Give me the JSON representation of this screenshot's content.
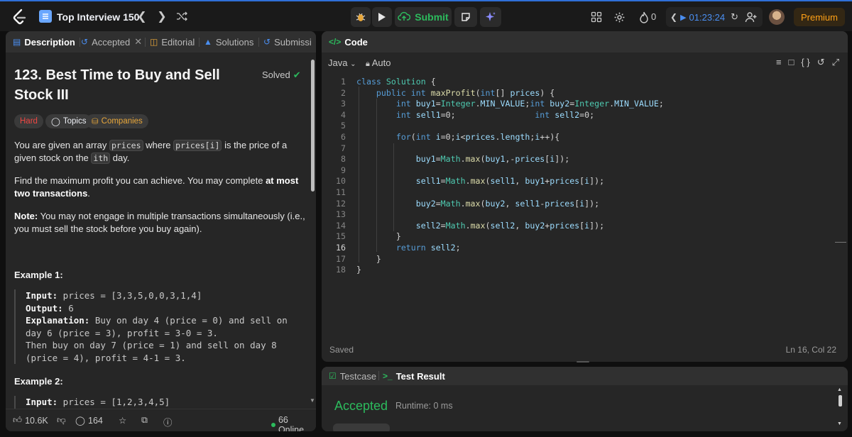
{
  "topbar": {
    "list_title": "Top Interview 150",
    "submit_label": "Submit",
    "streak_count": "0",
    "timer": "01:23:24",
    "premium_label": "Premium"
  },
  "left_tabs": [
    {
      "label": "Description"
    },
    {
      "label": "Accepted"
    },
    {
      "label": "Editorial"
    },
    {
      "label": "Solutions"
    },
    {
      "label": "Submissi"
    }
  ],
  "problem": {
    "title": "123. Best Time to Buy and Sell Stock III",
    "status": "Solved",
    "difficulty": "Hard",
    "topics_label": "Topics",
    "companies_label": "Companies",
    "p1_a": "You are given an array ",
    "p1_code1": "prices",
    "p1_b": " where ",
    "p1_code2": "prices[i]",
    "p1_c": " is the price of a given stock on the ",
    "p1_code3": "ith",
    "p1_d": " day.",
    "p2_a": "Find the maximum profit you can achieve. You may complete ",
    "p2_bold": "at most two transactions",
    "p2_b": ".",
    "p3_bold": "Note:",
    "p3_a": " You may not engage in multiple transactions simultaneously (i.e., you must sell the stock before you buy again).",
    "example1_title": "Example 1:",
    "example1_input_label": "Input:",
    "example1_input": " prices = [3,3,5,0,0,3,1,4]",
    "example1_output_label": "Output:",
    "example1_output": " 6",
    "example1_expl_label": "Explanation:",
    "example1_expl_1": " Buy on day 4 (price = 0) and sell on",
    "example1_expl_2": "day 6 (price = 3), profit = 3-0 = 3.",
    "example1_expl_3": "Then buy on day 7 (price = 1) and sell on day 8",
    "example1_expl_4": "(price = 4), profit = 4-1 = 3.",
    "example2_title": "Example 2:",
    "example2_input_label": "Input:",
    "example2_input": " prices = [1,2,3,4,5]"
  },
  "left_footer": {
    "likes": "10.6K",
    "comments": "164",
    "online": "66 Online"
  },
  "code_panel": {
    "tab_label": "Code",
    "language": "Java",
    "auto_label": "Auto",
    "saved_label": "Saved",
    "cursor_pos": "Ln 16, Col 22",
    "current_line": 16,
    "lines": [
      "class Solution {",
      "    public int maxProfit(int[] prices) {",
      "        int buy1=Integer.MIN_VALUE;int buy2=Integer.MIN_VALUE;",
      "        int sell1=0;                int sell2=0;",
      "",
      "        for(int i=0;i<prices.length;i++){",
      "",
      "            buy1=Math.max(buy1,-prices[i]);",
      "",
      "            sell1=Math.max(sell1, buy1+prices[i]);",
      "",
      "            buy2=Math.max(buy2, sell1-prices[i]);",
      "",
      "            sell2=Math.max(sell2, buy2+prices[i]);",
      "        }",
      "        return sell2;",
      "    }",
      "}"
    ]
  },
  "test_panel": {
    "testcase_label": "Testcase",
    "result_label": "Test Result",
    "verdict": "Accepted",
    "runtime": "Runtime: 0 ms"
  },
  "colors": {
    "accent_green": "#2cbb5d",
    "hard_red": "#ef4743",
    "premium_orange": "#ffa116",
    "timer_blue": "#4a8ef0"
  }
}
